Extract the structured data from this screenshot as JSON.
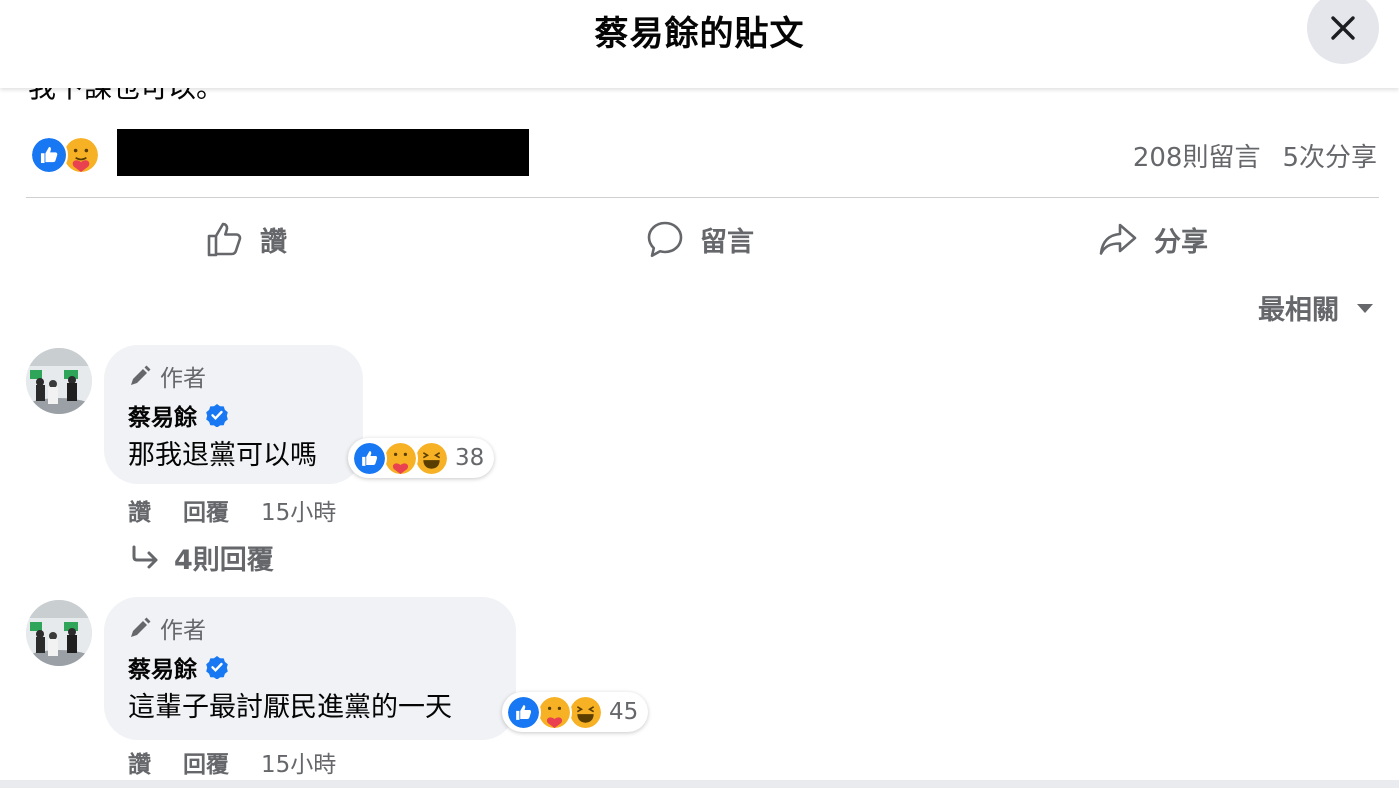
{
  "header": {
    "title": "蔡易餘的貼文"
  },
  "post": {
    "cut_text": "我下課也可以。",
    "summary_reactions": [
      "like-icon",
      "care-icon"
    ],
    "comment_count": "208則留言",
    "share_count": "5次分享"
  },
  "actions": {
    "like": "讚",
    "comment": "留言",
    "share": "分享"
  },
  "sort": {
    "label": "最相關"
  },
  "comments": [
    {
      "author_badge": "作者",
      "name": "蔡易餘",
      "text": "那我退黨可以嗎",
      "reactions": [
        "like-icon",
        "care-icon",
        "haha-icon"
      ],
      "reaction_count": "38",
      "like": "讚",
      "reply": "回覆",
      "time": "15小時",
      "replies": "4則回覆"
    },
    {
      "author_badge": "作者",
      "name": "蔡易餘",
      "text": "這輩子最討厭民進黨的一天",
      "reactions": [
        "like-icon",
        "care-icon",
        "haha-icon"
      ],
      "reaction_count": "45",
      "like": "讚",
      "reply": "回覆",
      "time": "15小時"
    }
  ],
  "colors": {
    "like_blue": "#1877f2",
    "reaction_yellow": "#f7b125",
    "muted_text": "#65676b",
    "bubble_bg": "#f0f2f5"
  }
}
